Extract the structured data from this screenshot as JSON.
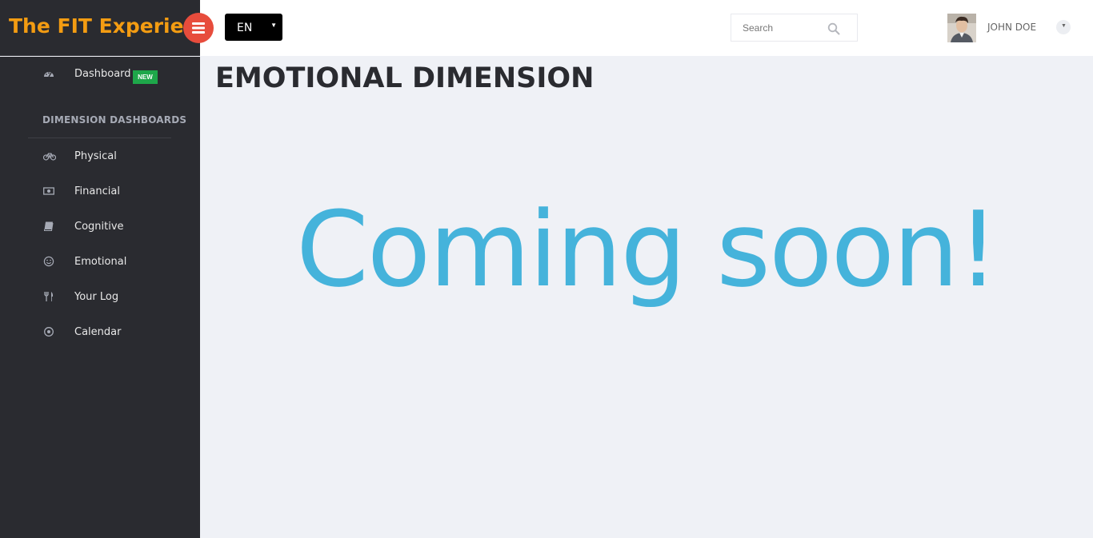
{
  "brand": {
    "title": "The FIT Experience",
    "color": "#f39c12"
  },
  "header": {
    "language": "EN",
    "search_placeholder": "Search",
    "user_name": "JOHN DOE",
    "toggle_color": "#e74c3c"
  },
  "sidebar": {
    "dashboard": {
      "label": "Dashboard",
      "badge": "NEW",
      "icon": "dashboard-icon"
    },
    "section_title": "DIMENSION DASHBOARDS",
    "items": [
      {
        "label": "Physical",
        "icon": "bicycle-icon"
      },
      {
        "label": "Financial",
        "icon": "money-icon"
      },
      {
        "label": "Cognitive",
        "icon": "book-icon"
      },
      {
        "label": "Emotional",
        "icon": "smile-icon"
      },
      {
        "label": "Your Log",
        "icon": "cutlery-icon"
      },
      {
        "label": "Calendar",
        "icon": "target-icon"
      }
    ]
  },
  "main": {
    "title": "EMOTIONAL DIMENSION",
    "message": "Coming soon!",
    "message_color": "#45b3db"
  }
}
